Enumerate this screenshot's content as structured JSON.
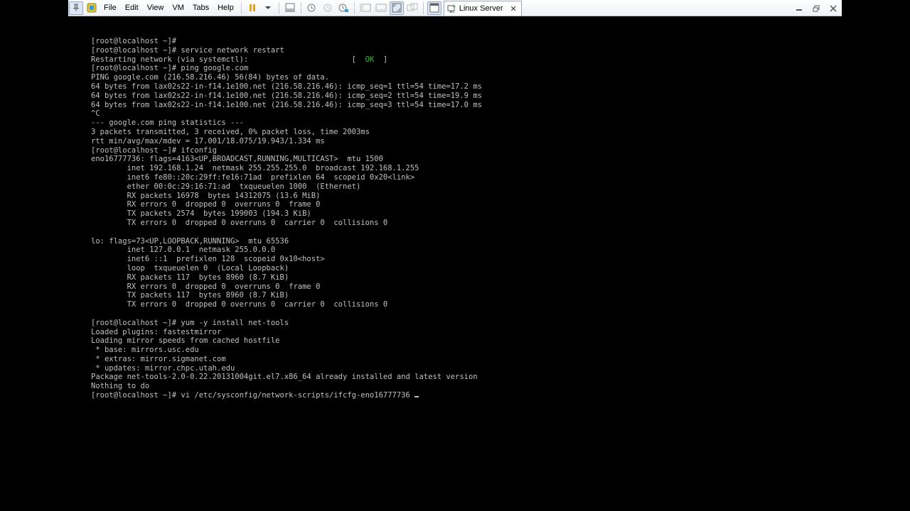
{
  "toolbar": {
    "menus": [
      "File",
      "Edit",
      "View",
      "VM",
      "Tabs",
      "Help"
    ],
    "tab_title": "Linux Server",
    "tab_close": "✕",
    "icons": [
      "pin-icon",
      "library-icon",
      "pause-icon",
      "dropdown-icon",
      "send-ctrl-alt-del-icon",
      "snapshot-icon",
      "revert-snapshot-icon",
      "snapshot-manager-icon",
      "sidebar-icon",
      "console-view-icon",
      "fullscreen-icon",
      "unity-icon",
      "thumbnail-icon",
      "vm-tab-icon"
    ]
  },
  "window_controls": {
    "minimize": "—",
    "restore": "❐",
    "close": "✕"
  },
  "terminal": {
    "lines": [
      "[root@localhost ~]# ",
      "[root@localhost ~]# service network restart",
      "Restarting network (via systemctl):                       [  ",
      "[root@localhost ~]# ping google.com",
      "PING google.com (216.58.216.46) 56(84) bytes of data.",
      "64 bytes from lax02s22-in-f14.1e100.net (216.58.216.46): icmp_seq=1 ttl=54 time=17.2 ms",
      "64 bytes from lax02s22-in-f14.1e100.net (216.58.216.46): icmp_seq=2 ttl=54 time=19.9 ms",
      "64 bytes from lax02s22-in-f14.1e100.net (216.58.216.46): icmp_seq=3 ttl=54 time=17.0 ms",
      "^C",
      "--- google.com ping statistics ---",
      "3 packets transmitted, 3 received, 0% packet loss, time 2003ms",
      "rtt min/avg/max/mdev = 17.001/18.075/19.943/1.334 ms",
      "[root@localhost ~]# ifconfig",
      "eno16777736: flags=4163<UP,BROADCAST,RUNNING,MULTICAST>  mtu 1500",
      "        inet 192.168.1.24  netmask 255.255.255.0  broadcast 192.168.1.255",
      "        inet6 fe80::20c:29ff:fe16:71ad  prefixlen 64  scopeid 0x20<link>",
      "        ether 00:0c:29:16:71:ad  txqueuelen 1000  (Ethernet)",
      "        RX packets 16978  bytes 14312075 (13.6 MiB)",
      "        RX errors 0  dropped 0  overruns 0  frame 0",
      "        TX packets 2574  bytes 199003 (194.3 KiB)",
      "        TX errors 0  dropped 0 overruns 0  carrier 0  collisions 0",
      "",
      "lo: flags=73<UP,LOOPBACK,RUNNING>  mtu 65536",
      "        inet 127.0.0.1  netmask 255.0.0.0",
      "        inet6 ::1  prefixlen 128  scopeid 0x10<host>",
      "        loop  txqueuelen 0  (Local Loopback)",
      "        RX packets 117  bytes 8960 (8.7 KiB)",
      "        RX errors 0  dropped 0  overruns 0  frame 0",
      "        TX packets 117  bytes 8960 (8.7 KiB)",
      "        TX errors 0  dropped 0 overruns 0  carrier 0  collisions 0",
      "",
      "[root@localhost ~]# yum -y install net-tools",
      "Loaded plugins: fastestmirror",
      "Loading mirror speeds from cached hostfile",
      " * base: mirrors.usc.edu",
      " * extras: mirror.sigmanet.com",
      " * updates: mirror.chpc.utah.edu",
      "Package net-tools-2.0-0.22.20131004git.el7.x86_64 already installed and latest version",
      "Nothing to do",
      "[root@localhost ~]# vi /etc/sysconfig/network-scripts/ifcfg-eno16777736 "
    ],
    "ok_status": "OK",
    "ok_suffix": "  ]",
    "colors": {
      "text": "#c0c0c0",
      "ok": "#2fbf2f",
      "background": "#000000"
    }
  }
}
